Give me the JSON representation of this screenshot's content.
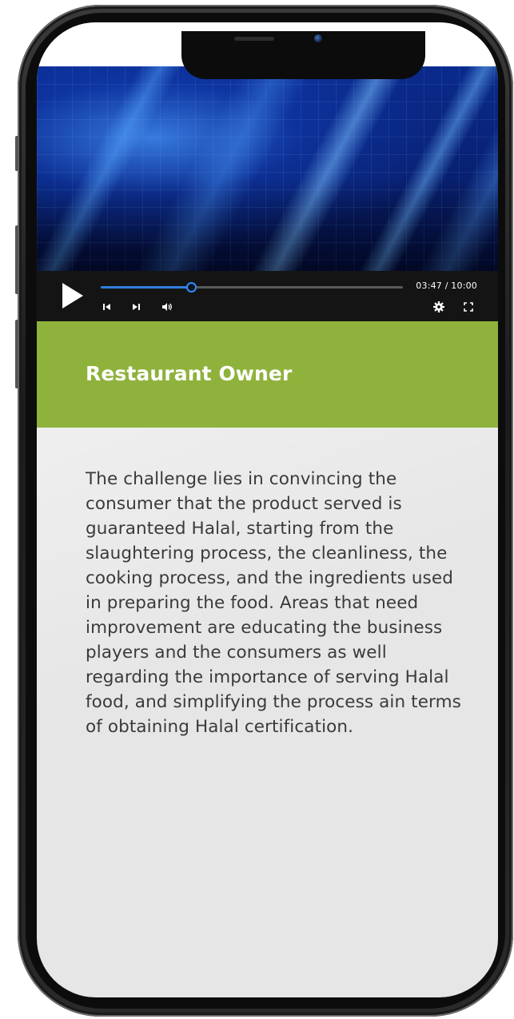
{
  "video": {
    "current_time": "03:47",
    "duration": "10:00",
    "time_display": "03:47 / 10:00",
    "progress_fraction": 0.3
  },
  "controls": {
    "play_icon": "play-icon",
    "prev_icon": "skip-previous-icon",
    "next_icon": "skip-next-icon",
    "volume_icon": "volume-icon",
    "settings_icon": "gear-icon",
    "fullscreen_icon": "fullscreen-icon"
  },
  "card": {
    "title": "Restaurant Owner",
    "body": "The challenge lies in convincing the consumer that the product served is guaranteed Halal, starting from the slaughtering process, the cleanliness, the cooking process, and the ingredients used in preparing the food. Areas that need improvement are educating the business players and the consumers as well regarding the importance of serving Halal food, and simplifying the process ain terms of obtaining Halal certification."
  },
  "colors": {
    "accent_green": "#8fb23c",
    "progress_blue": "#2f7fe0",
    "controls_bg": "#141414",
    "screen_bg": "#e6e6e6"
  }
}
